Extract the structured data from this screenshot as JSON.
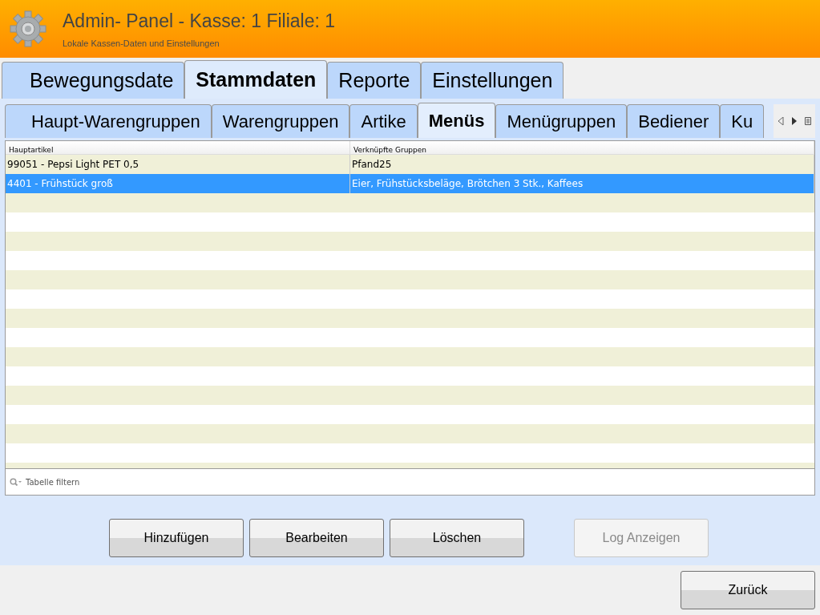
{
  "header": {
    "title": "Admin- Panel - Kasse: 1 Filiale: 1",
    "subtitle": "Lokale Kassen-Daten und Einstellungen"
  },
  "main_tabs": [
    {
      "label": "Bewegungsdate",
      "selected": false
    },
    {
      "label": "Stammdaten",
      "selected": true
    },
    {
      "label": "Reporte",
      "selected": false
    },
    {
      "label": "Einstellungen",
      "selected": false
    }
  ],
  "sub_tabs": [
    {
      "label": "Haupt-Warengruppen",
      "selected": false
    },
    {
      "label": "Warengruppen",
      "selected": false
    },
    {
      "label": "Artike",
      "selected": false
    },
    {
      "label": "Menüs",
      "selected": true
    },
    {
      "label": "Menügruppen",
      "selected": false
    },
    {
      "label": "Bediener",
      "selected": false
    },
    {
      "label": "Ku",
      "selected": false
    }
  ],
  "table": {
    "columns": [
      "Hauptartikel",
      "Verknüpfte Gruppen"
    ],
    "rows": [
      {
        "cells": [
          "99051 - Pepsi Light PET 0,5",
          "Pfand25"
        ],
        "selected": false
      },
      {
        "cells": [
          "4401 - Frühstück groß",
          "Eier, Frühstücksbeläge, Brötchen 3 Stk., Kaffees"
        ],
        "selected": true
      }
    ]
  },
  "filter": {
    "placeholder": "Tabelle filtern"
  },
  "buttons": [
    {
      "label": "Hinzufügen",
      "disabled": false
    },
    {
      "label": "Bearbeiten",
      "disabled": false
    },
    {
      "label": "Löschen",
      "disabled": false
    },
    {
      "label": "Log Anzeigen",
      "disabled": true
    }
  ],
  "back_button": {
    "label": "Zurück"
  }
}
